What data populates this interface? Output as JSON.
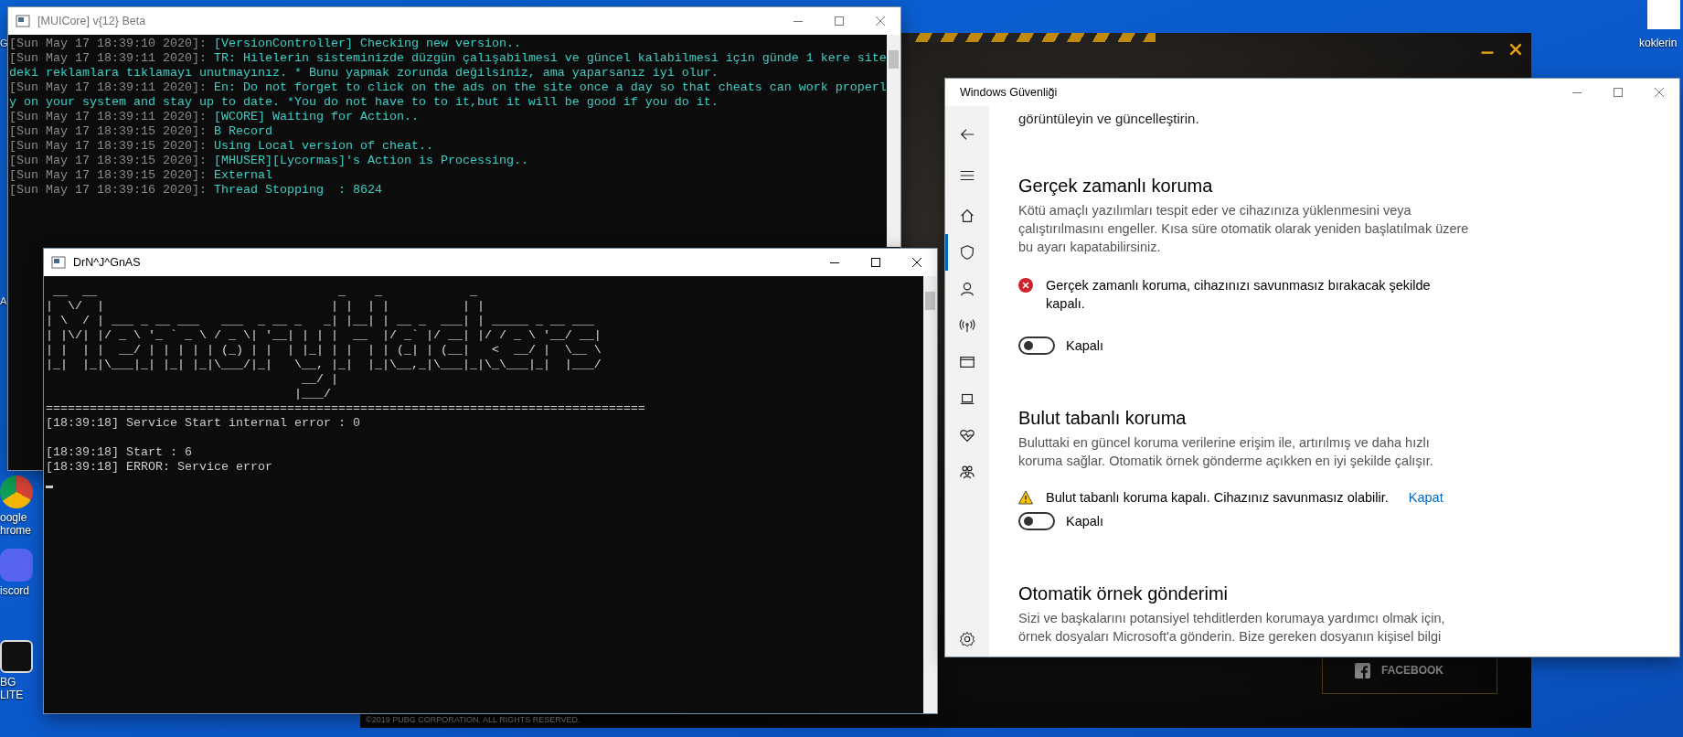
{
  "desktop": {
    "icons": [
      {
        "label": "G"
      },
      {
        "label": "A"
      },
      {
        "label": "oogle hrome"
      },
      {
        "label": "iscord"
      },
      {
        "label": "BG LITE"
      }
    ],
    "top_right_label": "koklerin"
  },
  "launcher": {
    "facebook": "FACEBOOK",
    "copyright": "©2019 PUBG CORPORATION. ALL RIGHTS RESERVED."
  },
  "console_window": {
    "title": "[MUICore] v{12} Beta",
    "lines": [
      {
        "time": "[Sun May 17 18:39:10 2020]:",
        "message": "[VersionController] Checking new version.."
      },
      {
        "time": "[Sun May 17 18:39:11 2020]:",
        "message": "TR: Hilelerin sisteminizde düzgün çalışabilmesi ve güncel kalabilmesi için günde 1 kere sitedeki reklamlara tıklamayı unutmayınız. * Bunu yapmak zorunda değilsiniz, ama yaparsanız iyi olur."
      },
      {
        "time": "[Sun May 17 18:39:11 2020]:",
        "message": "En: Do not forget to click on the ads on the site once a day so that cheats can work properly on your system and stay up to date. *You do not have to to it,but it will be good if you do it."
      },
      {
        "time": "[Sun May 17 18:39:11 2020]:",
        "message": "[WCORE] Waiting for Action.."
      },
      {
        "time": "[Sun May 17 18:39:15 2020]:",
        "message": "B Record"
      },
      {
        "time": "[Sun May 17 18:39:15 2020]:",
        "message": "Using Local version of cheat.."
      },
      {
        "time": "[Sun May 17 18:39:15 2020]:",
        "message": "[MHUSER][Lycormas]'s Action is Processing.."
      },
      {
        "time": "[Sun May 17 18:39:15 2020]:",
        "message": "External"
      },
      {
        "time": "[Sun May 17 18:39:16 2020]:",
        "message": "Thread Stopping  : 8624"
      }
    ]
  },
  "memory_window": {
    "title": "DrN^J^GnAS",
    "banner": [
      " __  __                                 _    _            _",
      "|  \\/  |                               | |  | |          | |",
      "| \\  / | ___ _ __ ___   ___  _ __ _   _| |__| | __ _  ___| | _____ _ __ ___",
      "| |\\/| |/ _ \\ '_ ` _ \\ / _ \\| '__| | | |  __  |/ _` |/ __| |/ / _ \\ '__/ __|",
      "| |  | |  __/ | | | | | (_) | |  | |_| | |  | | (_| | (__|   <  __/ |  \\__ \\",
      "|_|  |_|\\___|_| |_| |_|\\___/|_|   \\__, |_|  |_|\\__,_|\\___|_|\\_\\___|_|  |___/",
      "                                   __/ |",
      "                                  |___/"
    ],
    "separator": "==================================================================================",
    "blocks": [
      [
        "[18:39:18] Service Start internal error : 0"
      ],
      [
        "[18:39:18] Start : 6",
        "[18:39:18] ERROR: Service error"
      ]
    ]
  },
  "security_window": {
    "title": "Windows Güvenliği",
    "nav_items": [
      {
        "kind": "home",
        "selected": false
      },
      {
        "kind": "shield",
        "selected": true
      },
      {
        "kind": "person",
        "selected": false
      },
      {
        "kind": "antenna",
        "selected": false
      },
      {
        "kind": "window",
        "selected": false
      },
      {
        "kind": "laptop",
        "selected": false
      },
      {
        "kind": "heart",
        "selected": false
      },
      {
        "kind": "family",
        "selected": false
      }
    ],
    "top_fragment": "görüntüleyin ve güncelleştirin.",
    "sections": [
      {
        "heading": "Gerçek zamanlı koruma",
        "description": "Kötü amaçlı yazılımları tespit eder ve cihazınıza yüklenmesini veya çalıştırılmasını engeller. Kısa süre otomatik olarak yeniden başlatılmak üzere bu ayarı kapatabilirsiniz.",
        "alert": {
          "kind": "error",
          "text": "Gerçek zamanlı koruma, cihazınızı savunmasız bırakacak şekilde kapalı."
        },
        "toggle": {
          "on": false,
          "label": "Kapalı"
        }
      },
      {
        "heading": "Bulut tabanlı koruma",
        "description": "Buluttaki en güncel koruma verilerine erişim ile, artırılmış ve daha hızlı koruma sağlar. Otomatik örnek gönderme açıkken en iyi şekilde çalışır.",
        "alert": {
          "kind": "warning",
          "text": "Bulut tabanlı koruma kapalı. Cihazınız savunmasız olabilir.",
          "link": "Kapat"
        },
        "toggle": {
          "on": false,
          "label": "Kapalı"
        }
      },
      {
        "heading": "Otomatik örnek gönderimi",
        "description": "Sizi ve başkalarını potansiyel tehditlerden korumaya yardımcı olmak için, örnek dosyaları Microsoft'a gönderin. Bize gereken dosyanın kişisel bilgi"
      }
    ]
  }
}
